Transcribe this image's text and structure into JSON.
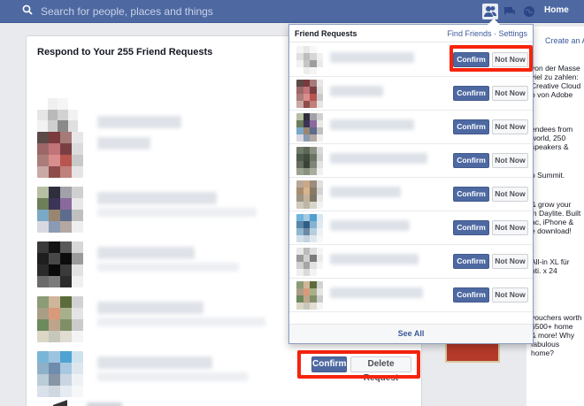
{
  "topbar": {
    "search_placeholder": "Search for people, places and things",
    "home_label": "Home",
    "icons": [
      "search-icon",
      "friend-requests-icon",
      "messages-icon",
      "notifications-icon"
    ]
  },
  "main": {
    "panel_title": "Respond to Your 255 Friend Requests",
    "confirm_label": "Confirm",
    "delete_label": "Delete Request"
  },
  "dropdown": {
    "title": "Friend Requests",
    "find_friends": "Find Friends",
    "separator": " · ",
    "settings": "Settings",
    "confirm_label": "Confirm",
    "not_now_label": "Not Now",
    "see_all": "See All"
  },
  "ads": {
    "create_ad": "Create an Ad",
    "ad1": "von der Masse\nviel zu zahlen:\nCreative Cloud\no von Adobe",
    "ad2": "endees from\nworld, 250\nspeakers &",
    "ad3": "o Summit.",
    "ad4": "& grow your\nin Daylite. Built\nac, iPhone &\ne download!",
    "ad5": "All-in XL für\nnti. x 24",
    "ad6": "vouchers worth\n6500+ home\n& more! Why\nfabulous\nhome?"
  },
  "colors": {
    "topbar": "#4e69a2",
    "confirm": "#4e69a2",
    "highlight": "#f7230c"
  }
}
